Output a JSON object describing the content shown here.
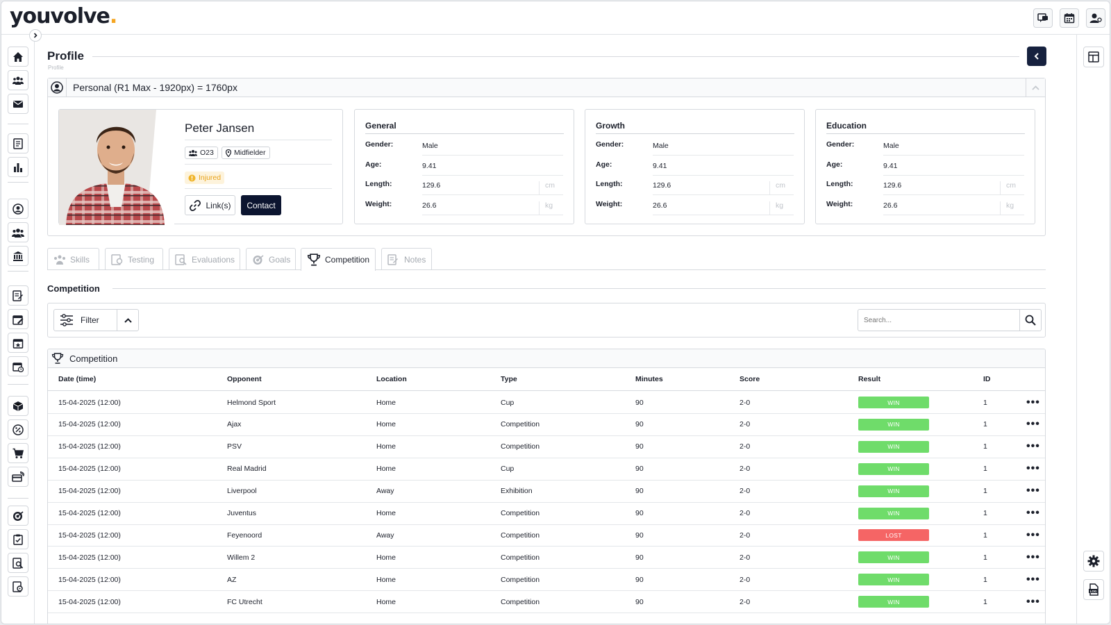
{
  "app": {
    "logo": "youvolve",
    "logo_dot": "."
  },
  "topbar": {
    "icons": [
      "chat-icon",
      "calendar-icon",
      "user-settings-icon"
    ]
  },
  "page": {
    "title": "Profile",
    "breadcrumb": "Profile"
  },
  "personal": {
    "title": "Personal (R1 Max - 1920px) = 1760px",
    "name_first": "Peter",
    "name_last": " Jansen",
    "team": "O23",
    "position": "Midfielder",
    "status": "Injured",
    "links_label": "Link(s)",
    "contact_label": "Contact"
  },
  "info_cards": [
    {
      "title": "General",
      "rows": [
        {
          "k": "Gender:",
          "v": "Male",
          "u": ""
        },
        {
          "k": "Age:",
          "v": "9.41",
          "u": ""
        },
        {
          "k": "Length:",
          "v": "129.6",
          "u": "cm"
        },
        {
          "k": "Weight:",
          "v": "26.6",
          "u": "kg"
        }
      ]
    },
    {
      "title": "Growth",
      "rows": [
        {
          "k": "Gender:",
          "v": "Male",
          "u": ""
        },
        {
          "k": "Age:",
          "v": "9.41",
          "u": ""
        },
        {
          "k": "Length:",
          "v": "129.6",
          "u": "cm"
        },
        {
          "k": "Weight:",
          "v": "26.6",
          "u": "kg"
        }
      ]
    },
    {
      "title": "Education",
      "rows": [
        {
          "k": "Gender:",
          "v": "Male",
          "u": ""
        },
        {
          "k": "Age:",
          "v": "9.41",
          "u": ""
        },
        {
          "k": "Length:",
          "v": "129.6",
          "u": "cm"
        },
        {
          "k": "Weight:",
          "v": "26.6",
          "u": "kg"
        }
      ]
    }
  ],
  "tabs": [
    {
      "label": "Skills",
      "icon": "skills-icon"
    },
    {
      "label": "Testing",
      "icon": "testing-icon"
    },
    {
      "label": "Evaluations",
      "icon": "evaluations-icon"
    },
    {
      "label": "Goals",
      "icon": "goals-icon"
    },
    {
      "label": "Competition",
      "icon": "trophy-icon",
      "active": true
    },
    {
      "label": "Notes",
      "icon": "notes-icon"
    }
  ],
  "competition": {
    "section_title": "Competition",
    "filter_label": "Filter",
    "search_placeholder": "Search...",
    "table_title": "Competition",
    "columns": [
      "Date (time)",
      "Opponent",
      "Location",
      "Type",
      "Minutes",
      "Score",
      "Result",
      "ID"
    ],
    "rows": [
      {
        "date": "15-04-2025 (12:00)",
        "opponent": "Helmond Sport",
        "location": "Home",
        "type": "Cup",
        "minutes": "90",
        "score": "2-0",
        "result": "WIN",
        "id": "1"
      },
      {
        "date": "15-04-2025 (12:00)",
        "opponent": "Ajax",
        "location": "Home",
        "type": "Competition",
        "minutes": "90",
        "score": "2-0",
        "result": "WIN",
        "id": "1"
      },
      {
        "date": "15-04-2025 (12:00)",
        "opponent": "PSV",
        "location": "Home",
        "type": "Competition",
        "minutes": "90",
        "score": "2-0",
        "result": "WIN",
        "id": "1"
      },
      {
        "date": "15-04-2025 (12:00)",
        "opponent": "Real Madrid",
        "location": "Home",
        "type": "Cup",
        "minutes": "90",
        "score": "2-0",
        "result": "WIN",
        "id": "1"
      },
      {
        "date": "15-04-2025 (12:00)",
        "opponent": "Liverpool",
        "location": "Away",
        "type": "Exhibition",
        "minutes": "90",
        "score": "2-0",
        "result": "WIN",
        "id": "1"
      },
      {
        "date": "15-04-2025 (12:00)",
        "opponent": "Juventus",
        "location": "Home",
        "type": "Competition",
        "minutes": "90",
        "score": "2-0",
        "result": "WIN",
        "id": "1"
      },
      {
        "date": "15-04-2025 (12:00)",
        "opponent": "Feyenoord",
        "location": "Away",
        "type": "Competition",
        "minutes": "90",
        "score": "2-0",
        "result": "LOST",
        "id": "1"
      },
      {
        "date": "15-04-2025 (12:00)",
        "opponent": "Willem 2",
        "location": "Home",
        "type": "Competition",
        "minutes": "90",
        "score": "2-0",
        "result": "WIN",
        "id": "1"
      },
      {
        "date": "15-04-2025 (12:00)",
        "opponent": "AZ",
        "location": "Home",
        "type": "Competition",
        "minutes": "90",
        "score": "2-0",
        "result": "WIN",
        "id": "1"
      },
      {
        "date": "15-04-2025 (12:00)",
        "opponent": "FC Utrecht",
        "location": "Home",
        "type": "Competition",
        "minutes": "90",
        "score": "2-0",
        "result": "WIN",
        "id": "1"
      }
    ]
  },
  "colors": {
    "primary": "#0c1530",
    "win": "#6fdc6a",
    "lost": "#f56565",
    "injured": "#e8a21a"
  }
}
